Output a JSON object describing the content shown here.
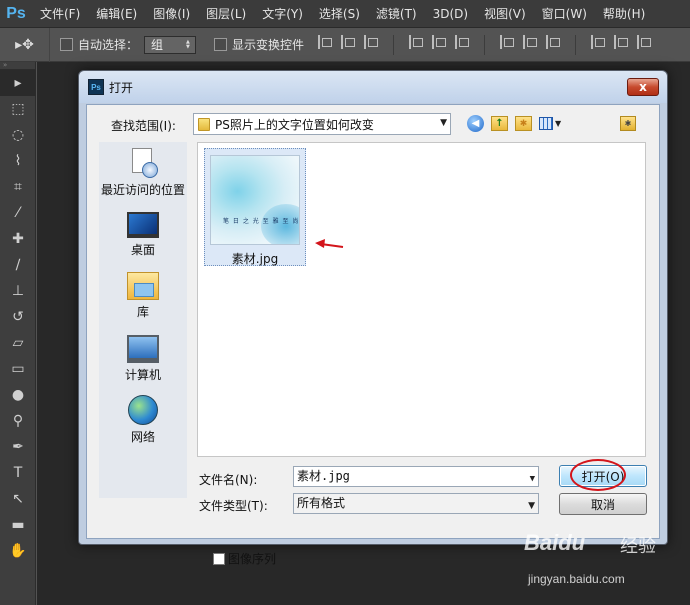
{
  "app": {
    "logo": "Ps",
    "menu": [
      "文件(F)",
      "编辑(E)",
      "图像(I)",
      "图层(L)",
      "文字(Y)",
      "选择(S)",
      "滤镜(T)",
      "3D(D)",
      "视图(V)",
      "窗口(W)",
      "帮助(H)"
    ]
  },
  "options": {
    "tool_icon": "move-tool-icon",
    "auto_select_label": "自动选择：",
    "auto_select_value": "组",
    "show_transform_label": "显示变换控件"
  },
  "tools": [
    "move",
    "marquee",
    "lasso",
    "quick-select",
    "crop",
    "eyedropper",
    "heal",
    "brush",
    "stamp",
    "history-brush",
    "eraser",
    "gradient",
    "blur",
    "dodge",
    "pen",
    "type",
    "path-select",
    "shape",
    "hand"
  ],
  "dialog": {
    "title_icon": "Ps",
    "title": "打开",
    "close_symbol": "x",
    "look_in_label": "查找范围(I):",
    "look_in_value": "PS照片上的文字位置如何改变",
    "places": [
      {
        "label": "最近访问的位置",
        "icon": "recent-places-icon"
      },
      {
        "label": "桌面",
        "icon": "desktop-icon"
      },
      {
        "label": "库",
        "icon": "libraries-icon"
      },
      {
        "label": "计算机",
        "icon": "computer-icon"
      },
      {
        "label": "网络",
        "icon": "network-icon"
      }
    ],
    "files": [
      {
        "name": "素材.jpg",
        "thumb_text": "笔 日 之 光  至 雅 至 尚"
      }
    ],
    "file_name_label": "文件名(N):",
    "file_name_value": "素材.jpg",
    "file_type_label": "文件类型(T):",
    "file_type_value": "所有格式",
    "open_button": "打开(O)",
    "cancel_button": "取消",
    "image_sequence_label": "图像序列"
  },
  "watermark": {
    "logo": "Baidu",
    "brand": "经验",
    "url": "jingyan.baidu.com"
  },
  "colors": {
    "annotation_red": "#d3151b",
    "ps_blue": "#55b4f0"
  }
}
